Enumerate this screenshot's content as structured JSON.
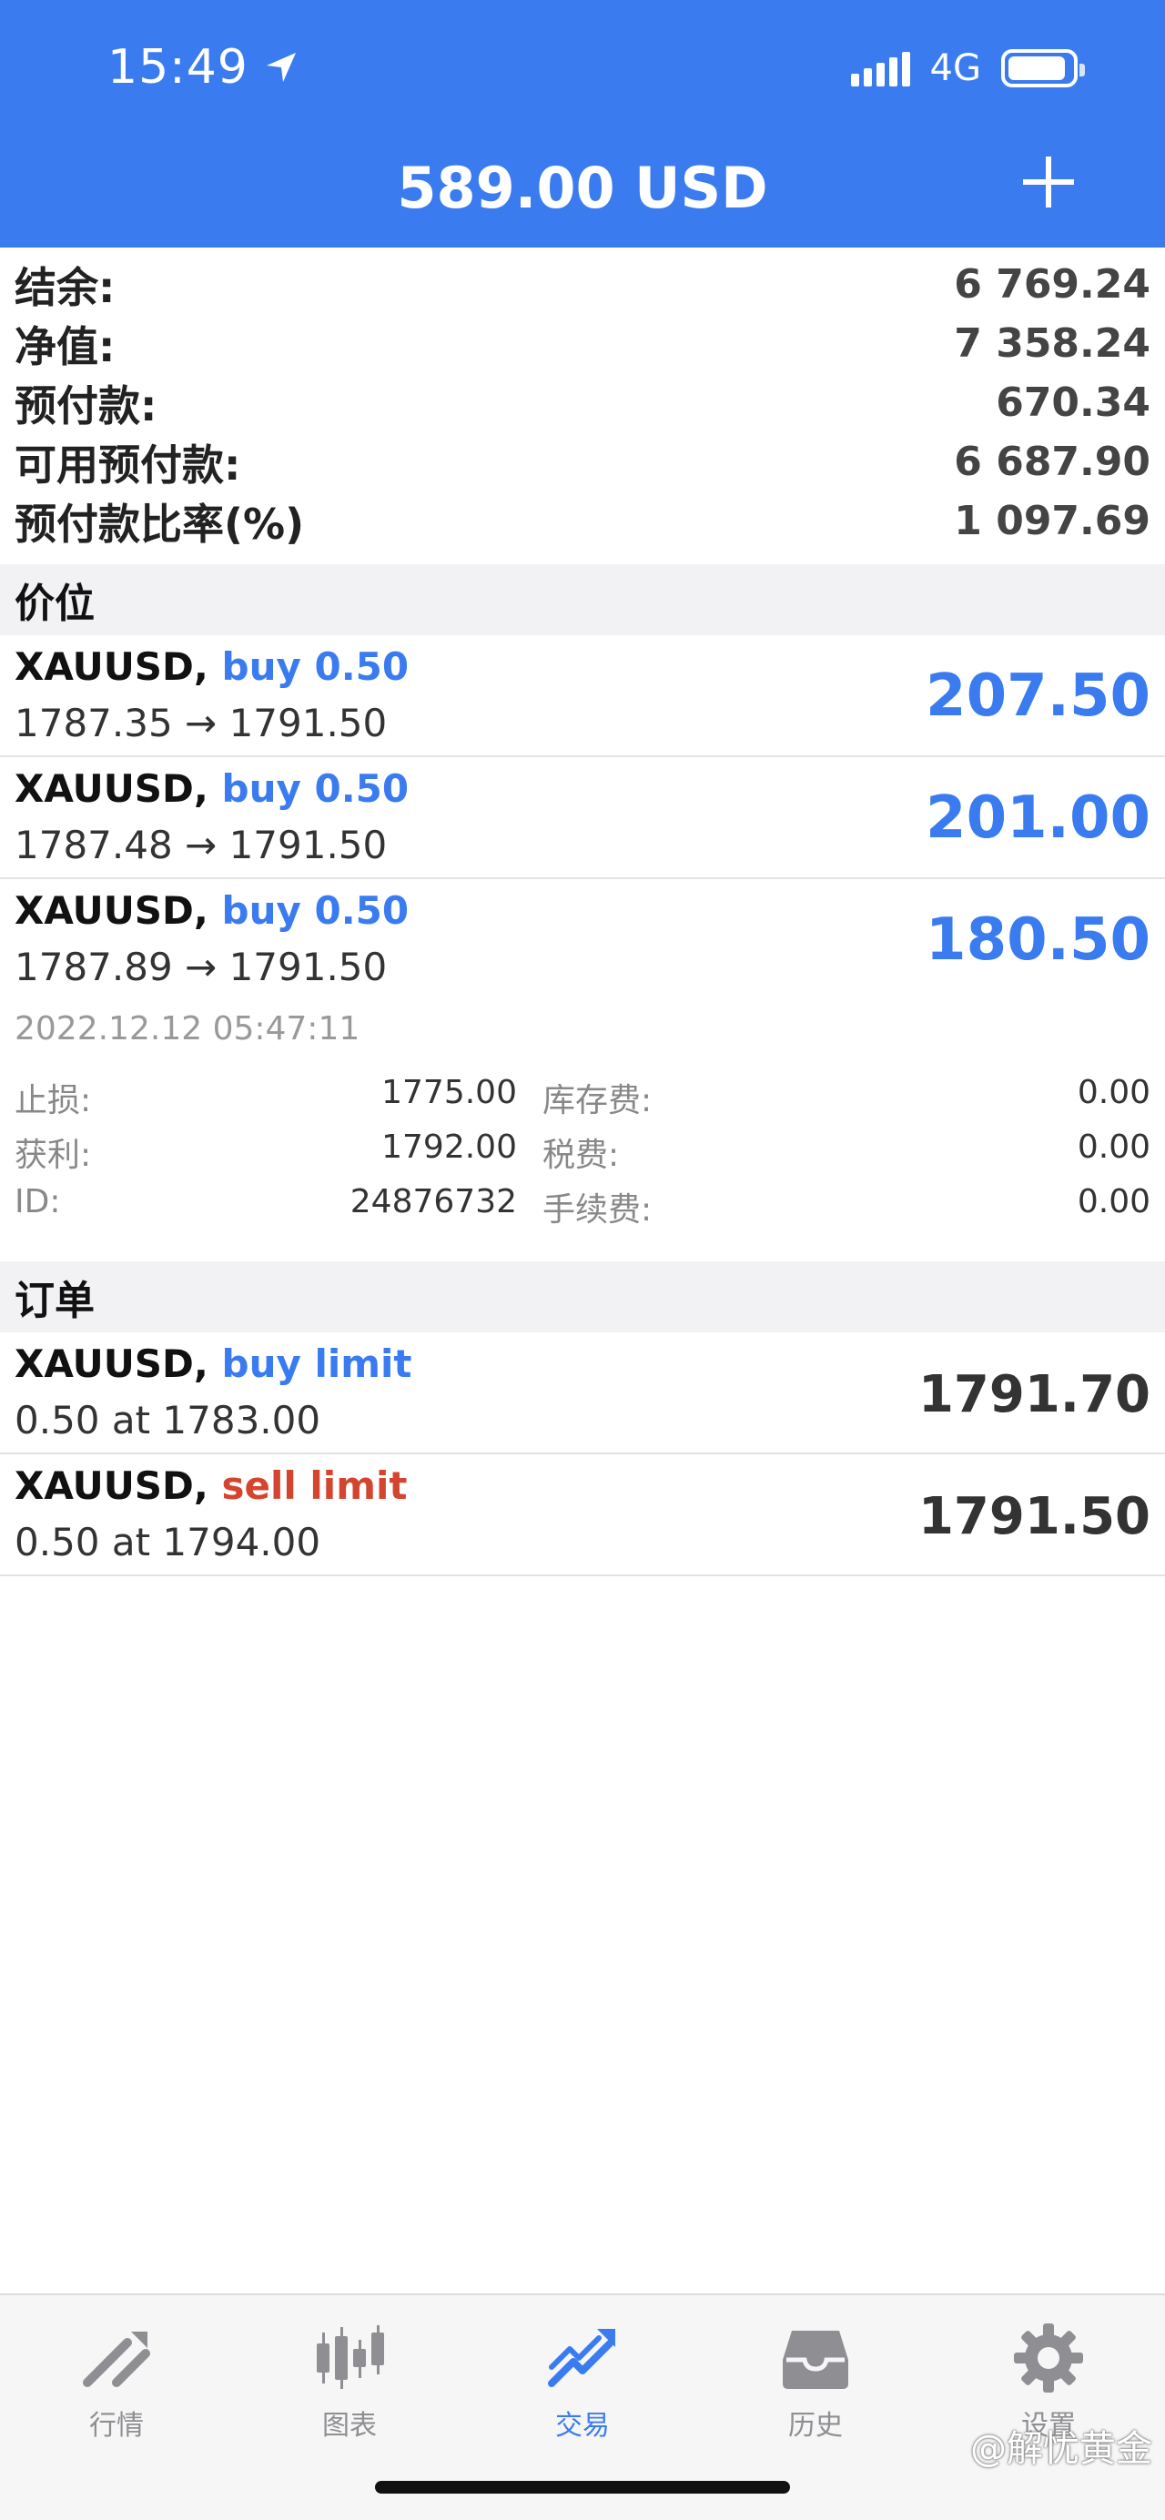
{
  "status_bar": {
    "time": "15:49",
    "network": "4G"
  },
  "header": {
    "title": "589.00 USD"
  },
  "summary": [
    {
      "label": "结余:",
      "value": "6 769.24"
    },
    {
      "label": "净值:",
      "value": "7 358.24"
    },
    {
      "label": "预付款:",
      "value": "670.34"
    },
    {
      "label": "可用预付款:",
      "value": "6 687.90"
    },
    {
      "label": "预付款比率(%)",
      "value": "1 097.69"
    }
  ],
  "positions_section": "价位",
  "positions": [
    {
      "symbol": "XAUUSD,",
      "side": "buy 0.50",
      "prices": "1787.35 → 1791.50",
      "profit": "207.50"
    },
    {
      "symbol": "XAUUSD,",
      "side": "buy 0.50",
      "prices": "1787.48 → 1791.50",
      "profit": "201.00"
    },
    {
      "symbol": "XAUUSD,",
      "side": "buy 0.50",
      "prices": "1787.89 → 1791.50",
      "profit": "180.50"
    }
  ],
  "position_detail": {
    "datetime": "2022.12.12 05:47:11",
    "rows": [
      {
        "k1": "止损:",
        "v1": "1775.00",
        "k2": "库存费:",
        "v2": "0.00"
      },
      {
        "k1": "获利:",
        "v1": "1792.00",
        "k2": "税费:",
        "v2": "0.00"
      },
      {
        "k1": "ID:",
        "v1": "24876732",
        "k2": "手续费:",
        "v2": "0.00"
      }
    ]
  },
  "orders_section": "订单",
  "orders": [
    {
      "symbol": "XAUUSD,",
      "side": "buy limit",
      "detail": "0.50 at 1783.00",
      "price": "1791.70"
    },
    {
      "symbol": "XAUUSD,",
      "side": "sell limit",
      "detail": "0.50 at 1794.00",
      "price": "1791.50"
    }
  ],
  "tabs": [
    {
      "label": "行情",
      "icon": "quotes-icon"
    },
    {
      "label": "图表",
      "icon": "chart-icon"
    },
    {
      "label": "交易",
      "icon": "trade-icon"
    },
    {
      "label": "历史",
      "icon": "history-icon"
    },
    {
      "label": "设置",
      "icon": "settings-icon"
    }
  ],
  "watermark": "@解忧黄金",
  "colors": {
    "accent": "#3a7cf0",
    "sell": "#d4452f"
  }
}
